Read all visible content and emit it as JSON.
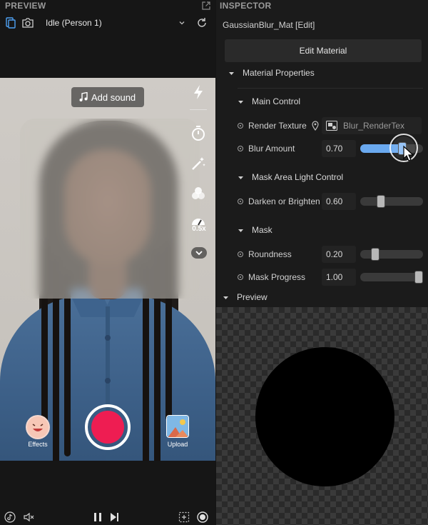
{
  "preview_panel": {
    "title": "PREVIEW",
    "state_select": {
      "value": "Idle (Person 1)"
    },
    "camera": {
      "add_sound_label": "Add sound",
      "speed_label": "0.5x",
      "effects_label": "Effects",
      "upload_label": "Upload"
    }
  },
  "inspector": {
    "title": "INSPECTOR",
    "material_name": "GaussianBlur_Mat [Edit]",
    "edit_material_label": "Edit Material",
    "material_properties_label": "Material Properties",
    "main_control": {
      "label": "Main Control",
      "render_texture_label": "Render Texture",
      "render_texture_value": "Blur_RenderTex",
      "blur_amount_label": "Blur Amount",
      "blur_amount_value": "0.70",
      "blur_amount_fraction": 0.7
    },
    "mask_area_light_control": {
      "label": "Mask Area Light Control",
      "darken_label": "Darken or Brighten",
      "darken_value": "0.60",
      "darken_fraction": 0.3
    },
    "mask": {
      "label": "Mask",
      "roundness_label": "Roundness",
      "roundness_value": "0.20",
      "roundness_fraction": 0.2,
      "progress_label": "Mask Progress",
      "progress_value": "1.00",
      "progress_fraction": 1.0
    },
    "preview_label": "Preview"
  },
  "colors": {
    "accent": "#6aa9ef",
    "record": "#ee1d52",
    "panel_bg": "#1b1b1b"
  }
}
